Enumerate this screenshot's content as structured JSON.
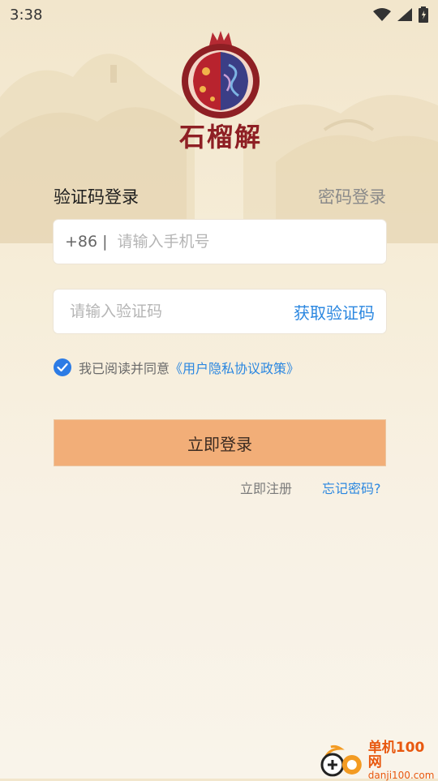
{
  "status_bar": {
    "time": "3:38"
  },
  "app": {
    "name": "石榴解"
  },
  "tabs": {
    "sms_login": "验证码登录",
    "password_login": "密码登录"
  },
  "phone": {
    "prefix": "+86",
    "divider": "|",
    "placeholder": "请输入手机号"
  },
  "code": {
    "placeholder": "请输入验证码",
    "get_code": "获取验证码"
  },
  "agreement": {
    "checked": true,
    "text": "我已阅读并同意",
    "link": "《用户隐私协议政策》"
  },
  "login_button": "立即登录",
  "links": {
    "register": "立即注册",
    "forgot": "忘记密码?"
  },
  "watermark": {
    "title": "单机100网",
    "url": "danji100.com"
  },
  "colors": {
    "accent": "#2b87e0",
    "button": "#f2ae78",
    "brand": "#8e1f24",
    "checkbox": "#2c7be5"
  }
}
